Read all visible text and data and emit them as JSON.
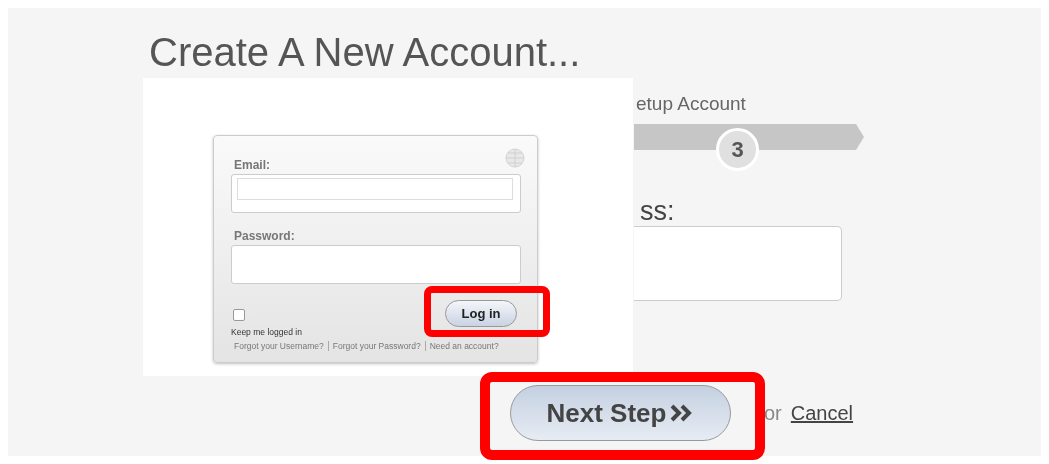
{
  "page": {
    "title": "Create A New Account..."
  },
  "step": {
    "label": "etup Account",
    "number": "3"
  },
  "field": {
    "label": "ss:"
  },
  "actions": {
    "next": {
      "label": "Next Step",
      "highlighted": true
    },
    "or": "or",
    "cancel": "Cancel"
  },
  "login_overlay": {
    "email_label": "Email:",
    "password_label": "Password:",
    "remember": {
      "label": "Keep me logged in",
      "checked": false
    },
    "login_button": {
      "label": "Log in",
      "highlighted": true
    },
    "links": [
      "Forgot your Username?",
      "Forgot your Password?",
      "Need an account?"
    ]
  }
}
